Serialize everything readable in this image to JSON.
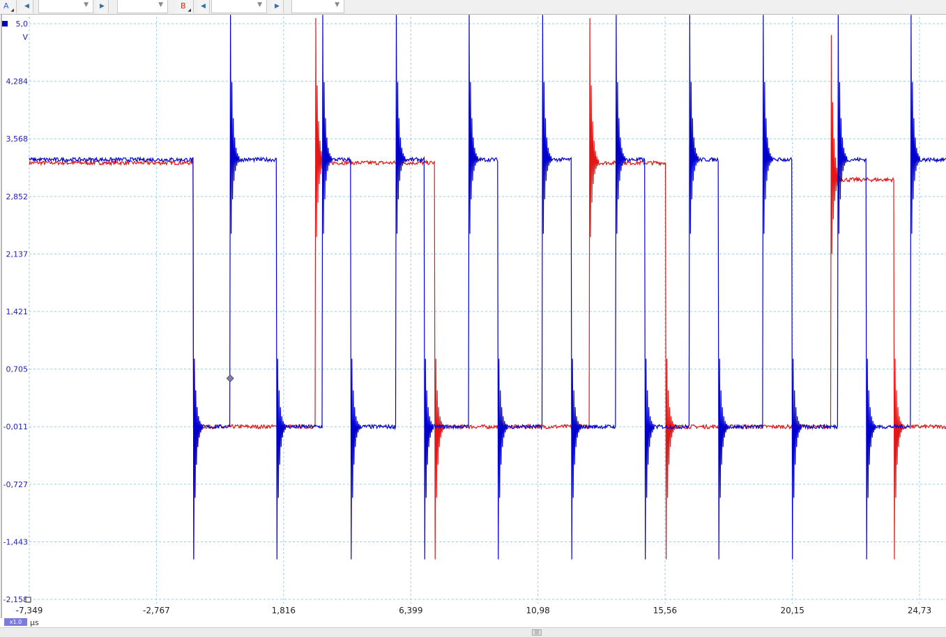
{
  "toolbar": {
    "channel_a": {
      "label": "A",
      "color": "#2c5fd9"
    },
    "channel_b": {
      "label": "B",
      "color": "#e02020"
    },
    "nav_prev_icon": "triangle-left-icon",
    "nav_next_icon": "triangle-right-icon",
    "combo_values": [
      "",
      "",
      "",
      ""
    ]
  },
  "axis": {
    "y_unit": "V",
    "x_unit": "µs",
    "zoom": "x1.0"
  },
  "colors": {
    "channel_a": "#0000cc",
    "channel_b": "#e01818",
    "axis_text": "#2020c0",
    "grid": "#9ccbe0"
  },
  "chart_data": {
    "type": "line",
    "title": "",
    "xlabel": "µs",
    "ylabel": "V",
    "xlim": [
      -7.349,
      26.0
    ],
    "ylim": [
      -2.158,
      5.0
    ],
    "y_ticks": [
      5.0,
      4.284,
      3.568,
      2.852,
      2.137,
      1.421,
      0.705,
      -0.011,
      -0.727,
      -1.443,
      -2.158
    ],
    "y_tick_labels": [
      "5,0",
      "4,284",
      "3,568",
      "2,852",
      "2,137",
      "1,421",
      "0,705",
      "-0,011",
      "-0,727",
      "-1,443",
      "-2,158"
    ],
    "x_ticks": [
      -7.349,
      -2.767,
      1.816,
      6.399,
      10.98,
      15.56,
      20.15,
      24.73
    ],
    "x_tick_labels": [
      "-7,349",
      "-2,767",
      "1,816",
      "6,399",
      "10,98",
      "15,56",
      "20,15",
      "24,73"
    ],
    "grid": true,
    "series": [
      {
        "name": "A",
        "levels": [
          3.31,
          -0.011
        ],
        "start_level": 3.31,
        "transitions": [
          -1.43,
          -0.11,
          1.57,
          3.22,
          4.23,
          5.86,
          6.88,
          8.49,
          9.53,
          11.14,
          12.19,
          13.8,
          14.84,
          16.45,
          17.5,
          19.08,
          20.15,
          21.78,
          22.82,
          24.42
        ]
      },
      {
        "name": "B",
        "levels": [
          3.27,
          -0.011
        ],
        "start_level": 3.27,
        "transitions": [
          -1.43,
          2.96,
          7.26,
          12.84,
          15.6,
          21.55,
          23.81
        ],
        "low_segments": [
          {
            "from": 21.55,
            "to": 23.81,
            "level": 3.06
          }
        ]
      }
    ],
    "cursor_marker": {
      "x": -0.11,
      "y": 0.59
    }
  }
}
